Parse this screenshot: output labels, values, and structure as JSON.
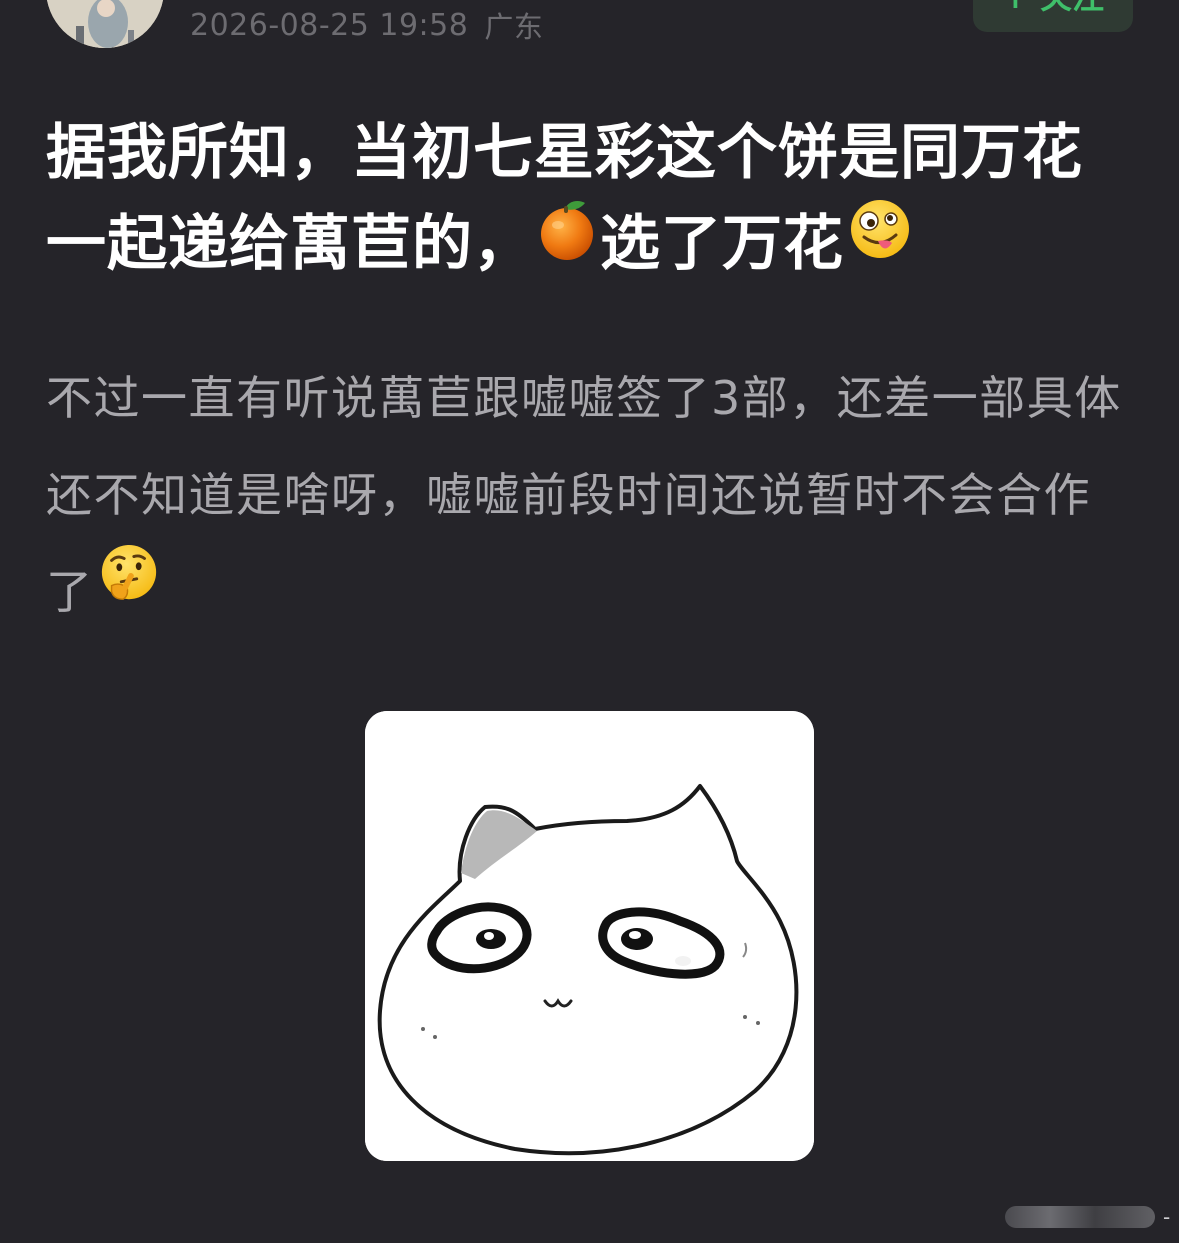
{
  "post": {
    "timestamp": "2026-08-25 19:58",
    "location": "广东",
    "follow_label": "+ 关注",
    "title_parts": [
      "据我所知，当初七星彩这个饼是同万花一起递给萬苣的，",
      "选了万花"
    ],
    "body_parts": [
      "不过一直有听说萬苣跟嘘嘘签了3部，还差一部具体还不知道是啥呀，嘘嘘前段时间还说暂时不会合作了"
    ],
    "emojis": [
      "tangerine-emoji",
      "zany-face-emoji",
      "thinking-face-emoji"
    ]
  },
  "watermark": {
    "trailing": "-"
  },
  "colors": {
    "background": "#252429",
    "title": "#ffffff",
    "body": "#a9a8ad",
    "meta": "#6d6c71",
    "follow": "#3fbf6a"
  }
}
